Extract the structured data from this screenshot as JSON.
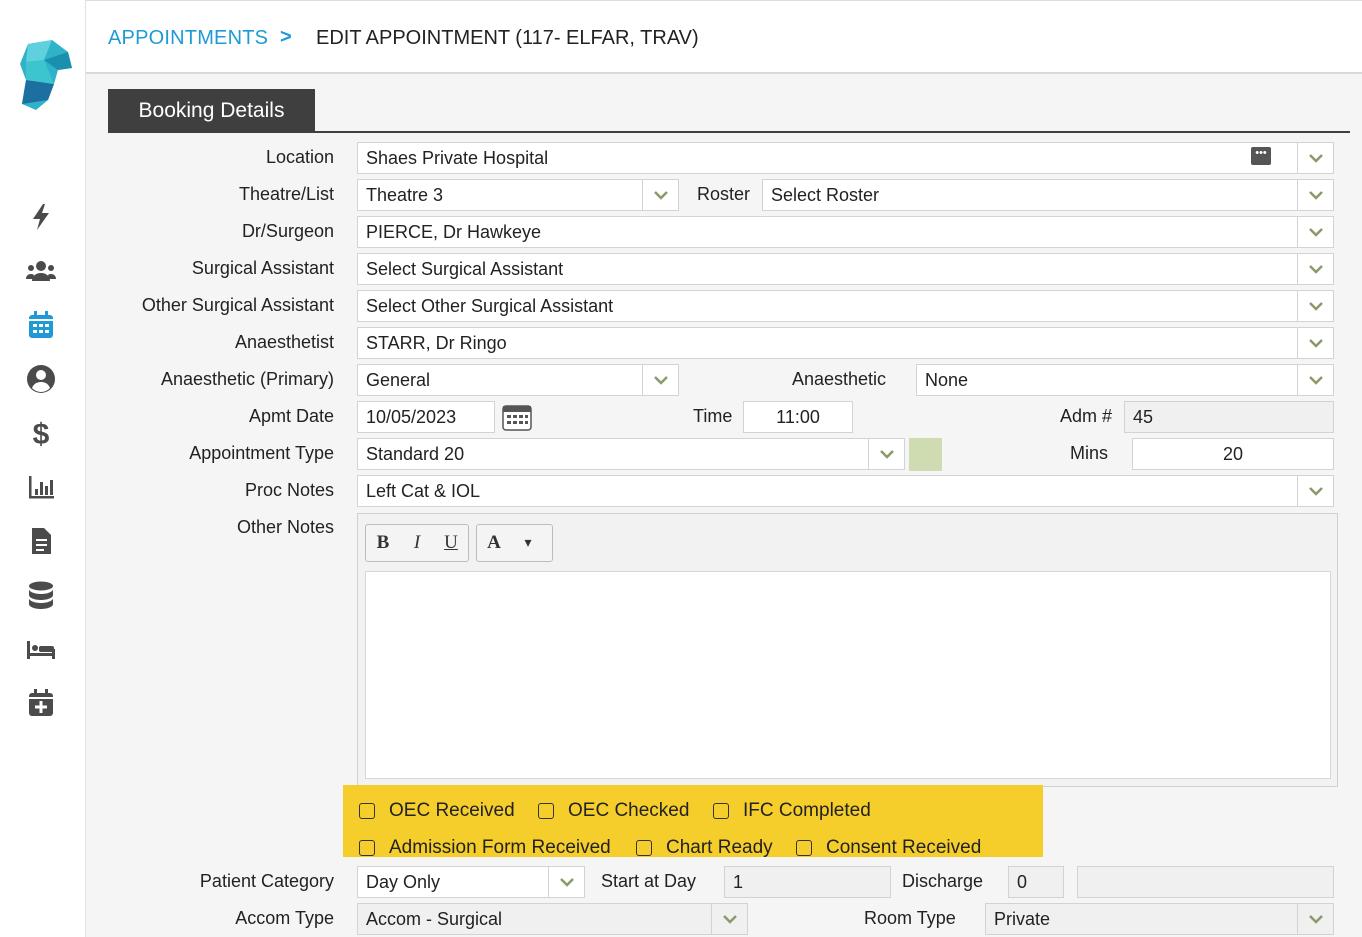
{
  "breadcrumb": {
    "parent": "APPOINTMENTS",
    "separator": ">",
    "current": "EDIT APPOINTMENT (117- ELFAR, TRAV)"
  },
  "tab": {
    "label": "Booking Details"
  },
  "form": {
    "location": {
      "label": "Location",
      "value": "Shaes Private Hospital"
    },
    "theatre": {
      "label": "Theatre/List",
      "value": "Theatre 3"
    },
    "roster": {
      "label": "Roster",
      "value": "Select Roster"
    },
    "surgeon": {
      "label": "Dr/Surgeon",
      "value": "PIERCE, Dr Hawkeye"
    },
    "surgical_assistant": {
      "label": "Surgical Assistant",
      "value": "Select Surgical Assistant"
    },
    "other_surgical_assistant": {
      "label": "Other Surgical Assistant",
      "value": "Select Other Surgical Assistant"
    },
    "anaesthetist": {
      "label": "Anaesthetist",
      "value": "STARR, Dr Ringo"
    },
    "anaesthetic_primary": {
      "label": "Anaesthetic (Primary)",
      "value": "General"
    },
    "anaesthetic": {
      "label": "Anaesthetic",
      "value": "None"
    },
    "apmt_date": {
      "label": "Apmt Date",
      "value": "10/05/2023"
    },
    "time": {
      "label": "Time",
      "value": "11:00"
    },
    "adm_no": {
      "label": "Adm #",
      "value": "45"
    },
    "appointment_type": {
      "label": "Appointment Type",
      "value": "Standard 20",
      "swatch_color": "#cfdbb0"
    },
    "mins": {
      "label": "Mins",
      "value": "20"
    },
    "proc_notes": {
      "label": "Proc Notes",
      "value": "Left Cat & IOL"
    },
    "other_notes": {
      "label": "Other Notes"
    },
    "patient_category": {
      "label": "Patient Category",
      "value": "Day Only"
    },
    "start_at_day": {
      "label": "Start at Day",
      "value": "1"
    },
    "discharge": {
      "label": "Discharge",
      "value": "0"
    },
    "accom_type": {
      "label": "Accom Type",
      "value": "Accom - Surgical"
    },
    "room_type": {
      "label": "Room Type",
      "value": "Private"
    }
  },
  "editor": {
    "bold": "B",
    "italic": "I",
    "underline": "U",
    "font_color": "A",
    "dropdown": "▾"
  },
  "checklist": {
    "highlight_color": "#f6ce2c",
    "items": [
      {
        "label": "OEC Received",
        "checked": false
      },
      {
        "label": "OEC Checked",
        "checked": false
      },
      {
        "label": "IFC Completed",
        "checked": false
      },
      {
        "label": "Admission Form Received",
        "checked": false
      },
      {
        "label": "Chart Ready",
        "checked": false
      },
      {
        "label": "Consent Received",
        "checked": false
      }
    ]
  },
  "sidebar": {
    "icons": [
      "lightning-icon",
      "users-icon",
      "calendar-icon",
      "user-circle-icon",
      "dollar-icon",
      "chart-icon",
      "document-icon",
      "database-icon",
      "bed-icon",
      "calendar-plus-icon"
    ],
    "active_color": "#1e9bd6",
    "icon_color": "#4b4b4b"
  },
  "colors": {
    "link": "#1e9bd6",
    "tab_bg": "#3f3f3f",
    "dropdown_arrow": "#8a9a6a"
  }
}
